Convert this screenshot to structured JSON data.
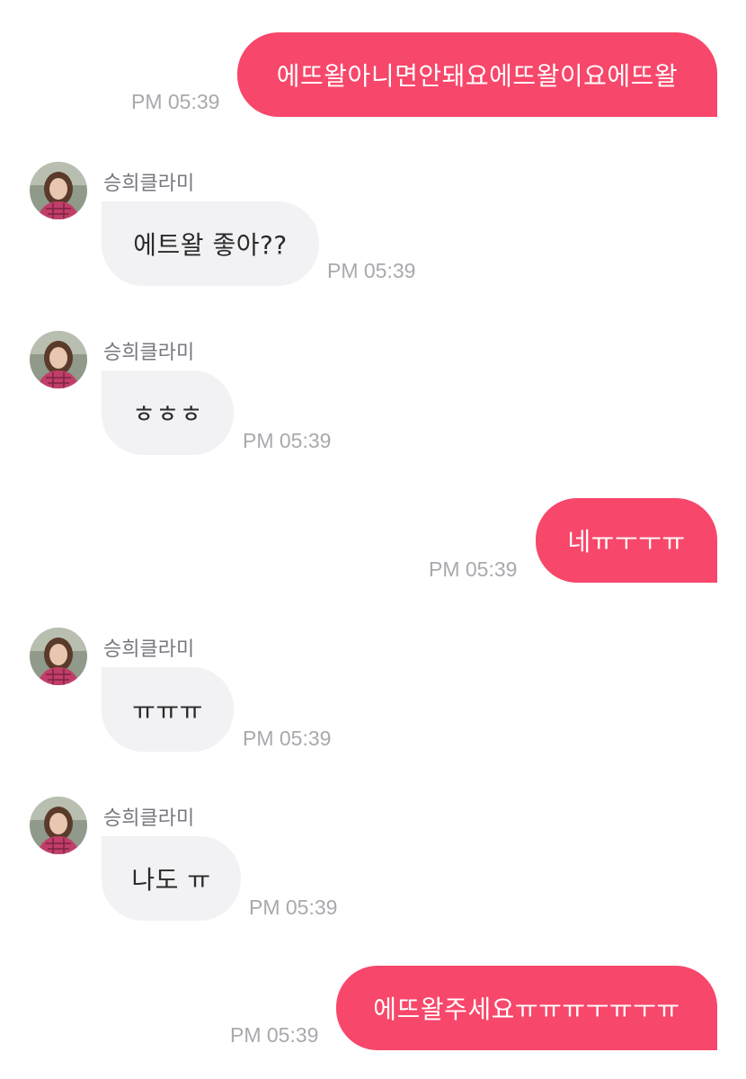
{
  "messages": [
    {
      "direction": "outgoing",
      "text": "에뜨왈아니면안돼요에뜨왈이요에뜨왈",
      "time": "PM 05:39"
    },
    {
      "direction": "incoming",
      "sender": "승희클라미",
      "text": "에트왈 좋아??",
      "time": "PM 05:39"
    },
    {
      "direction": "incoming",
      "sender": "승희클라미",
      "text": "ㅎㅎㅎ",
      "time": "PM 05:39"
    },
    {
      "direction": "outgoing",
      "text": "네ㅠㅜㅜㅠ",
      "time": "PM 05:39"
    },
    {
      "direction": "incoming",
      "sender": "승희클라미",
      "text": "ㅠㅠㅠ",
      "time": "PM 05:39"
    },
    {
      "direction": "incoming",
      "sender": "승희클라미",
      "text": "나도 ㅠ",
      "time": "PM 05:39"
    },
    {
      "direction": "outgoing",
      "text": "에뜨왈주세요ㅠㅠㅠㅜㅠㅜㅠ",
      "time": "PM 05:39"
    }
  ],
  "colors": {
    "outgoing_bubble": "#f7476a",
    "incoming_bubble": "#f2f2f5",
    "timestamp": "#a9a9ae"
  }
}
